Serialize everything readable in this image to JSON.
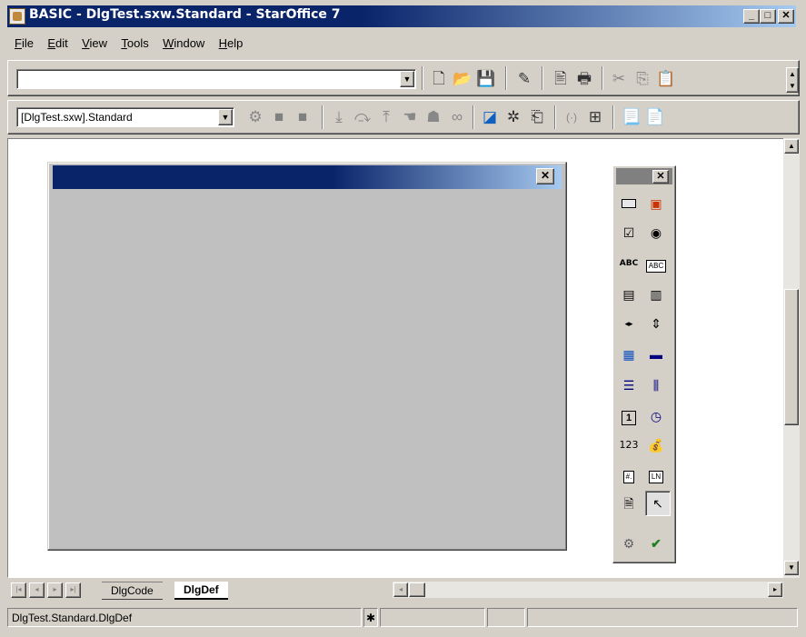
{
  "window": {
    "title": "BASIC - DlgTest.sxw.Standard - StarOffice 7",
    "controls": {
      "minimize": "_",
      "maximize": "□",
      "close": "✕"
    }
  },
  "menu": [
    {
      "label": "File",
      "accel": "F"
    },
    {
      "label": "Edit",
      "accel": "E"
    },
    {
      "label": "View",
      "accel": "V"
    },
    {
      "label": "Tools",
      "accel": "T"
    },
    {
      "label": "Window",
      "accel": "W"
    },
    {
      "label": "Help",
      "accel": "H"
    }
  ],
  "function_bar": {
    "url_value": "",
    "icons": [
      "new-icon",
      "open-icon",
      "save-icon",
      "edit-file-icon",
      "export-pdf-icon",
      "print-icon",
      "cut-icon",
      "copy-icon",
      "paste-icon"
    ]
  },
  "macro_bar": {
    "library_value": "[DlgTest.sxw].Standard",
    "icons": [
      "compile-icon",
      "run-icon",
      "stop-icon",
      "step-into-icon",
      "step-over-icon",
      "step-out-icon",
      "breakpoint-icon",
      "manage-breakpoints-icon",
      "watch-icon",
      "object-catalog-icon",
      "macros-icon",
      "modules-icon",
      "find-parentheses-icon",
      "controls-icon",
      "insert-source-icon",
      "save-source-icon"
    ]
  },
  "dialog": {
    "title": "",
    "close": "✕"
  },
  "toolbox": {
    "close": "✕",
    "tools": [
      {
        "name": "button-tool-icon",
        "glyph": "▭"
      },
      {
        "name": "image-control-tool-icon",
        "glyph": "🖻"
      },
      {
        "name": "check-box-tool-icon",
        "glyph": "☑"
      },
      {
        "name": "option-button-tool-icon",
        "glyph": "◉"
      },
      {
        "name": "label-tool-icon",
        "glyph": "ABC"
      },
      {
        "name": "text-box-tool-icon",
        "glyph": "ABC"
      },
      {
        "name": "list-box-tool-icon",
        "glyph": "▤"
      },
      {
        "name": "combo-box-tool-icon",
        "glyph": "▥"
      },
      {
        "name": "horizontal-scrollbar-tool-icon",
        "glyph": "◂▸"
      },
      {
        "name": "vertical-scrollbar-tool-icon",
        "glyph": "⇕"
      },
      {
        "name": "group-box-tool-icon",
        "glyph": "▦"
      },
      {
        "name": "progress-bar-tool-icon",
        "glyph": "▬"
      },
      {
        "name": "horizontal-line-tool-icon",
        "glyph": "☰"
      },
      {
        "name": "vertical-line-tool-icon",
        "glyph": "⫼"
      },
      {
        "name": "date-field-tool-icon",
        "glyph": "1"
      },
      {
        "name": "time-field-tool-icon",
        "glyph": "🕘"
      },
      {
        "name": "numeric-field-tool-icon",
        "glyph": "123"
      },
      {
        "name": "currency-field-tool-icon",
        "glyph": "$"
      },
      {
        "name": "formatted-field-tool-icon",
        "glyph": "#."
      },
      {
        "name": "pattern-field-tool-icon",
        "glyph": "LN"
      },
      {
        "name": "file-selection-tool-icon",
        "glyph": "📄"
      },
      {
        "name": "select-tool-icon",
        "glyph": "↖"
      },
      {
        "name": "properties-tool-icon",
        "glyph": "⚙"
      },
      {
        "name": "activate-test-mode-tool-icon",
        "glyph": "✔"
      }
    ]
  },
  "tabs": {
    "nav": [
      "|◂",
      "◂",
      "▸",
      "▸|"
    ],
    "items": [
      {
        "label": "DlgCode",
        "active": false
      },
      {
        "label": "DlgDef",
        "active": true
      }
    ]
  },
  "status": {
    "location": "DlgTest.Standard.DlgDef",
    "modified_marker": "✱"
  },
  "colors": {
    "titlebar": "#0a246a",
    "titlebar_end": "#a6caf0",
    "face": "#d4d0c8",
    "dialog_face": "#c0c0c0"
  }
}
